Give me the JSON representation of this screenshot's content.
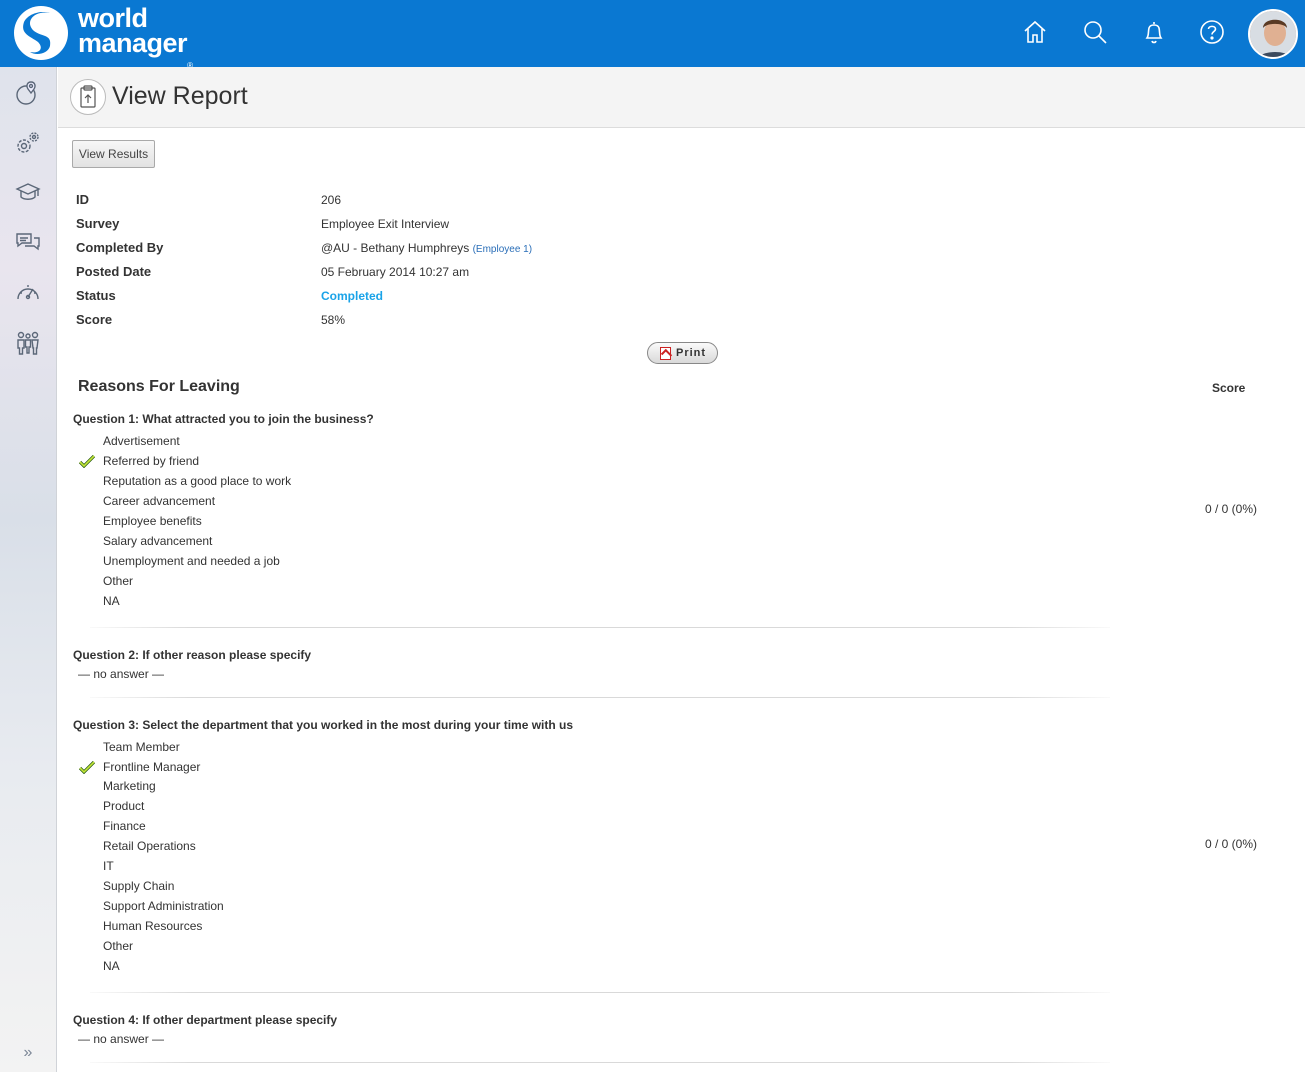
{
  "header": {
    "brand_line1": "world",
    "brand_line2": "manager",
    "brand_reg": "®",
    "icons": [
      "home-icon",
      "search-icon",
      "bell-icon",
      "help-icon"
    ],
    "accent": "#0a78d2"
  },
  "sidebar": {
    "items": [
      "location-icon",
      "settings-icon",
      "learning-icon",
      "chat-icon",
      "dashboard-icon",
      "people-icon"
    ],
    "expand_label": "»"
  },
  "page": {
    "title": "View Report",
    "view_results_label": "View Results",
    "print_label": "Print"
  },
  "report": {
    "fields": [
      {
        "label": "ID",
        "value": "206"
      },
      {
        "label": "Survey",
        "value": "Employee Exit Interview"
      },
      {
        "label": "Completed By",
        "value": "@AU - Bethany Humphreys",
        "extra": "(Employee 1)"
      },
      {
        "label": "Posted Date",
        "value": "05 February 2014 10:27 am"
      },
      {
        "label": "Status",
        "value": "Completed"
      },
      {
        "label": "Score",
        "value": "58%"
      }
    ],
    "status_color": "#1aa3e8"
  },
  "section": {
    "title": "Reasons For Leaving",
    "score_header": "Score"
  },
  "questions": [
    {
      "title": "Question 1: What attracted you to join the business?",
      "options": [
        "Advertisement",
        "Referred by friend",
        "Reputation as a good place to work",
        "Career advancement",
        "Employee benefits",
        "Salary advancement",
        "Unemployment and needed a job",
        "Other",
        "NA"
      ],
      "selected": "Referred by friend",
      "score": "0 / 0 (0%)"
    },
    {
      "title": "Question 2: If other reason please specify",
      "answer": "— no answer —"
    },
    {
      "title": "Question 3: Select the department that you worked in the most during your time with us",
      "options": [
        "Team Member",
        "Frontline Manager",
        "Marketing",
        "Product",
        "Finance",
        "Retail Operations",
        "IT",
        "Supply Chain",
        "Support Administration",
        "Human Resources",
        "Other",
        "NA"
      ],
      "selected": "Frontline Manager",
      "score": "0 / 0 (0%)"
    },
    {
      "title": "Question 4: If other department please specify",
      "answer": "— no answer —"
    }
  ]
}
